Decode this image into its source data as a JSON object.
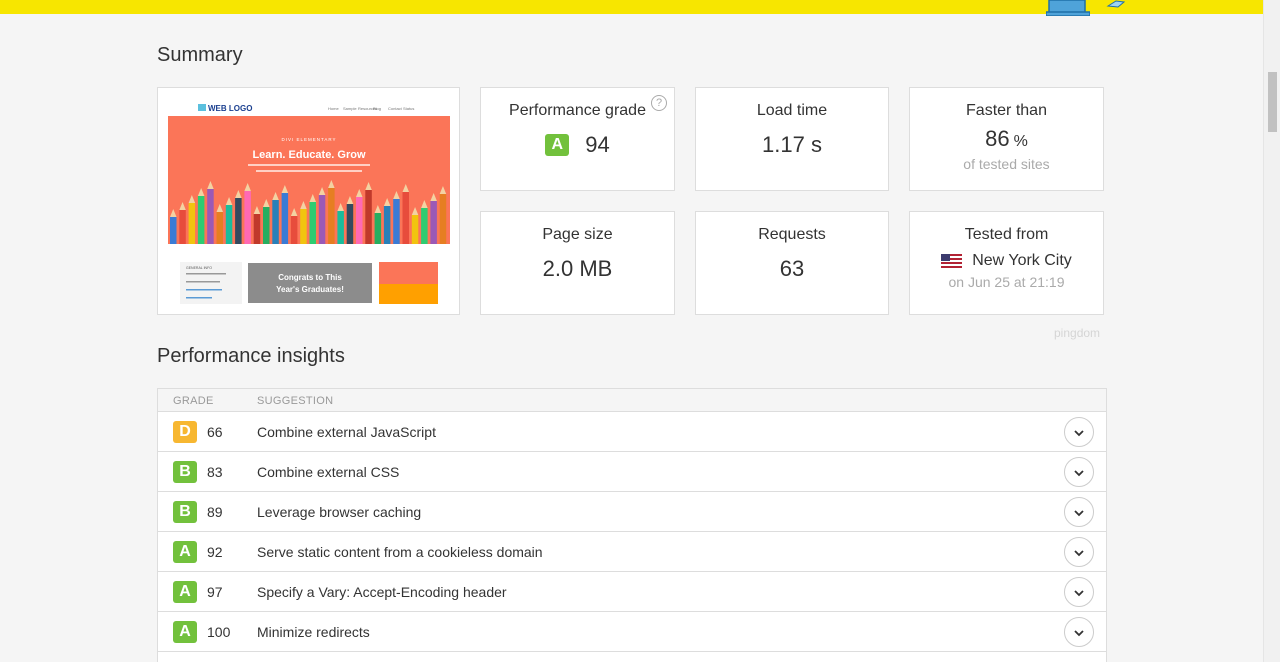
{
  "summary": {
    "title": "Summary",
    "performance": {
      "label": "Performance grade",
      "grade": "A",
      "score": "94",
      "help": "?"
    },
    "load_time": {
      "label": "Load time",
      "value": "1.17 s"
    },
    "faster": {
      "label": "Faster than",
      "value": "86",
      "unit": "%",
      "sub": "of tested sites"
    },
    "page_size": {
      "label": "Page size",
      "value": "2.0 MB"
    },
    "requests": {
      "label": "Requests",
      "value": "63"
    },
    "tested": {
      "label": "Tested from",
      "city": "New York City",
      "date": "on Jun 25 at 21:19"
    },
    "brand": "pingdom"
  },
  "thumbnail": {
    "logo": "WEB LOGO",
    "nav": [
      "Home",
      "Sample",
      "Resources",
      "Blog",
      "Contact",
      "Status"
    ],
    "kicker": "DIVI ELEMENTARY",
    "headline": "Learn. Educate. Grow",
    "congrats": "Congrats to This Year's Graduates!",
    "info_title": "GENERAL INFO"
  },
  "insights": {
    "title": "Performance insights",
    "columns": {
      "grade": "GRADE",
      "suggestion": "SUGGESTION"
    },
    "rows": [
      {
        "grade": "D",
        "score": "66",
        "suggestion": "Combine external JavaScript",
        "color": "#f7b731"
      },
      {
        "grade": "B",
        "score": "83",
        "suggestion": "Combine external CSS",
        "color": "#72c13c"
      },
      {
        "grade": "B",
        "score": "89",
        "suggestion": "Leverage browser caching",
        "color": "#72c13c"
      },
      {
        "grade": "A",
        "score": "92",
        "suggestion": "Serve static content from a cookieless domain",
        "color": "#72c13c"
      },
      {
        "grade": "A",
        "score": "97",
        "suggestion": "Specify a Vary: Accept-Encoding header",
        "color": "#72c13c"
      },
      {
        "grade": "A",
        "score": "100",
        "suggestion": "Minimize redirects",
        "color": "#72c13c"
      }
    ]
  },
  "colors": {
    "accent_yellow": "#f7e600",
    "grade_a": "#72c13c",
    "grade_d": "#f7b731"
  }
}
